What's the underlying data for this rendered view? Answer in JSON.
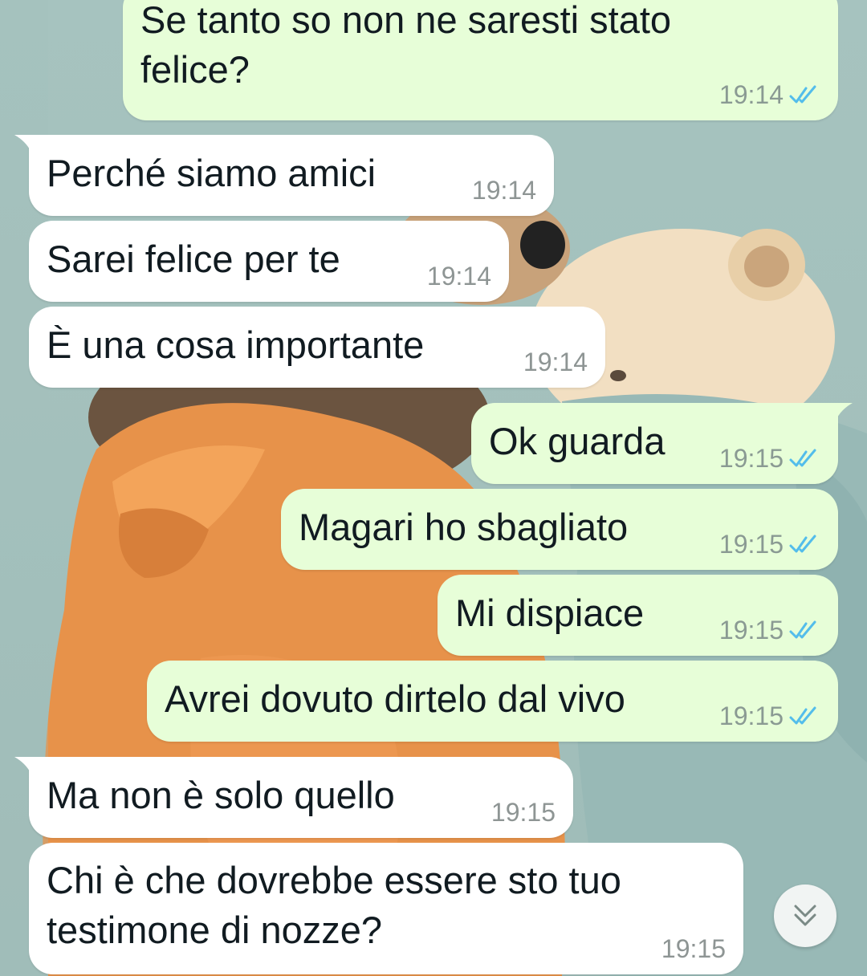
{
  "messages": [
    {
      "dir": "out",
      "text": "Se tanto so non ne saresti stato\nfelice?",
      "time": "19:14",
      "read": true
    },
    {
      "dir": "in",
      "text": "Perché siamo amici",
      "time": "19:14"
    },
    {
      "dir": "in",
      "text": "Sarei felice per te",
      "time": "19:14"
    },
    {
      "dir": "in",
      "text": "È una cosa importante",
      "time": "19:14"
    },
    {
      "dir": "out",
      "text": "Ok guarda",
      "time": "19:15",
      "read": true
    },
    {
      "dir": "out",
      "text": "Magari ho sbagliato",
      "time": "19:15",
      "read": true
    },
    {
      "dir": "out",
      "text": "Mi dispiace",
      "time": "19:15",
      "read": true
    },
    {
      "dir": "out",
      "text": "Avrei dovuto dirtelo dal vivo",
      "time": "19:15",
      "read": true
    },
    {
      "dir": "in",
      "text": "Ma non è solo quello",
      "time": "19:15"
    },
    {
      "dir": "in",
      "text": "Chi è che dovrebbe essere sto tuo\ntestimone di nozze?",
      "time": "19:15"
    }
  ],
  "scroll_button": {
    "icon": "double-chevron-down-icon"
  },
  "colors": {
    "outgoing_bubble": "#e7fed8",
    "incoming_bubble": "#ffffff",
    "read_tick": "#53bdeb",
    "wallpaper": "#a6c3bf"
  }
}
